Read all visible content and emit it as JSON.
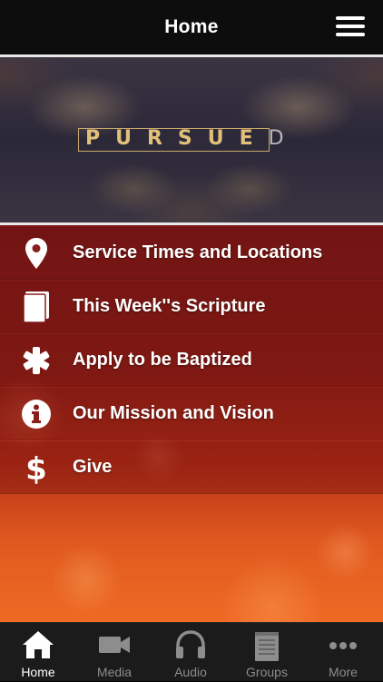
{
  "header": {
    "title": "Home",
    "menu_icon": "hamburger-menu-icon"
  },
  "banner": {
    "title_main": "PURSUE",
    "title_faded": "D"
  },
  "menu": {
    "items": [
      {
        "label": "Service Times and Locations",
        "icon": "location-pin-icon"
      },
      {
        "label": "This Week''s Scripture",
        "icon": "book-icon"
      },
      {
        "label": "Apply to be Baptized",
        "icon": "asterisk-icon"
      },
      {
        "label": "Our Mission and Vision",
        "icon": "info-icon"
      },
      {
        "label": "Give",
        "icon": "dollar-icon"
      }
    ]
  },
  "tabbar": {
    "tabs": [
      {
        "label": "Home",
        "icon": "home-icon",
        "active": true
      },
      {
        "label": "Media",
        "icon": "video-camera-icon"
      },
      {
        "label": "Audio",
        "icon": "headphones-icon"
      },
      {
        "label": "Groups",
        "icon": "notepad-icon"
      },
      {
        "label": "More",
        "icon": "more-dots-icon"
      }
    ]
  },
  "colors": {
    "header_bg": "#0d0d0d",
    "accent_gold": "#e2c07a",
    "tabbar_bg": "#1b1b1b"
  }
}
